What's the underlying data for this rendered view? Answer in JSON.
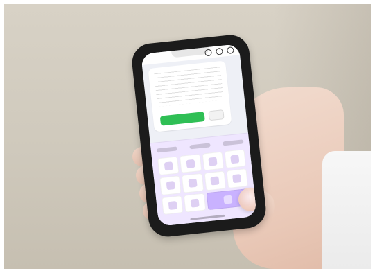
{
  "scene": {
    "phone_case_color": "#1b1b1b",
    "screen_background": "#eef0f6",
    "menu_background": "#efe6ff",
    "highlight_tile_color": "#c9b2ff",
    "confirm_button_color": "#2fbf55"
  }
}
